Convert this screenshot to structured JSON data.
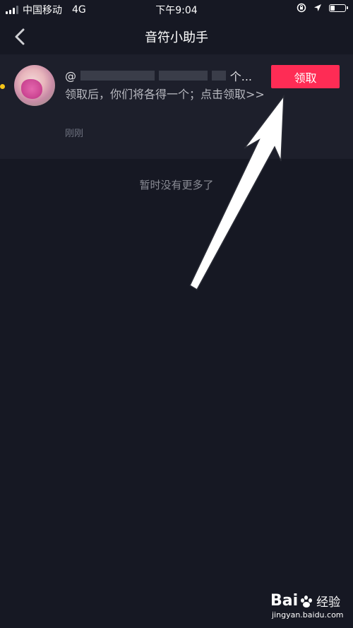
{
  "status_bar": {
    "carrier": "中国移动",
    "network": "4G",
    "time": "下午9:04"
  },
  "nav": {
    "title": "音符小助手"
  },
  "message": {
    "sender_prefix": "@",
    "sender_suffix": "个...",
    "text": "领取后，你们将各得一个；点击领取>>",
    "time": "刚刚",
    "claim_label": "领取"
  },
  "footer": {
    "no_more_text": "暂时没有更多了"
  },
  "watermark": {
    "brand_left": "Bai",
    "brand_right": "经验",
    "url": "jingyan.baidu.com"
  },
  "colors": {
    "background": "#161823",
    "card": "#1d1f2b",
    "accent": "#fe2c55",
    "unread_dot": "#f5c518"
  },
  "icons": {
    "back": "chevron-left-icon",
    "location": "location-arrow-icon",
    "lock_rotation": "rotation-lock-icon",
    "battery": "battery-icon",
    "signal": "signal-bars-icon"
  }
}
